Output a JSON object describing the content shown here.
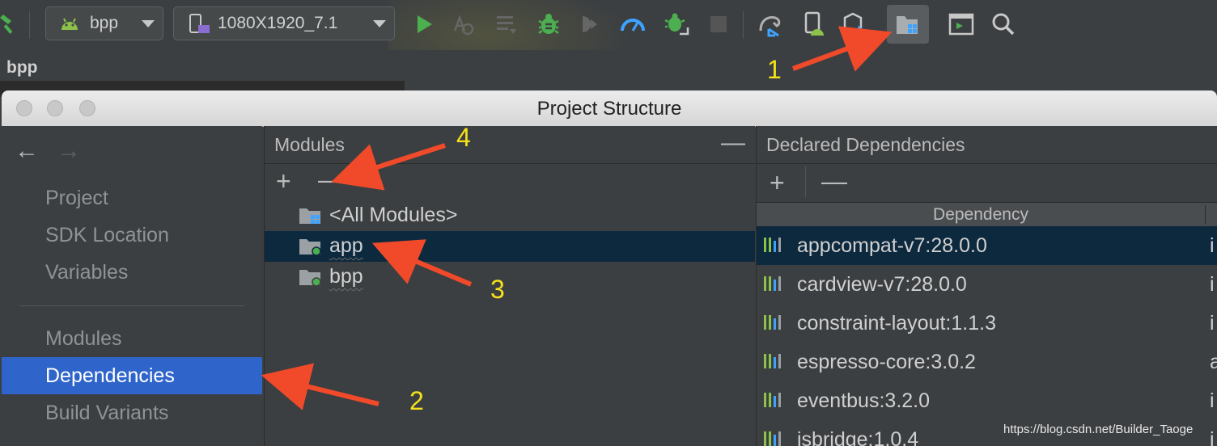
{
  "toolbar": {
    "module_combo": "bpp",
    "device_combo": "1080X1920_7.1"
  },
  "breadcrumb": "bpp",
  "dialog": {
    "title": "Project Structure",
    "nav": {
      "back": "←",
      "forward": "→",
      "items": [
        "Project",
        "SDK Location",
        "Variables"
      ],
      "items2": [
        "Modules",
        "Dependencies",
        "Build Variants"
      ],
      "selected": "Dependencies"
    },
    "modules": {
      "title": "Modules",
      "collapse": "—",
      "add": "+",
      "remove": "—",
      "tree": [
        "<All Modules>",
        "app",
        "bpp"
      ],
      "selected": "app"
    },
    "dependencies": {
      "title": "Declared Dependencies",
      "add": "+",
      "remove": "—",
      "column": "Dependency",
      "rows": [
        {
          "name": "appcompat-v7:28.0.0",
          "extra": "i"
        },
        {
          "name": "cardview-v7:28.0.0",
          "extra": "i"
        },
        {
          "name": "constraint-layout:1.1.3",
          "extra": "i"
        },
        {
          "name": "espresso-core:3.0.2",
          "extra": "a"
        },
        {
          "name": "eventbus:3.2.0",
          "extra": "i"
        },
        {
          "name": "jsbridge:1.0.4",
          "extra": "i"
        }
      ]
    }
  },
  "annotations": [
    "1",
    "2",
    "3",
    "4"
  ],
  "watermark": "https://blog.csdn.net/Builder_Taoge",
  "colors": {
    "selection": "#2f65ca",
    "row_selection": "#0d293e",
    "annotation_arrow": "#f04a2a",
    "annotation_number": "#f5e21b"
  }
}
